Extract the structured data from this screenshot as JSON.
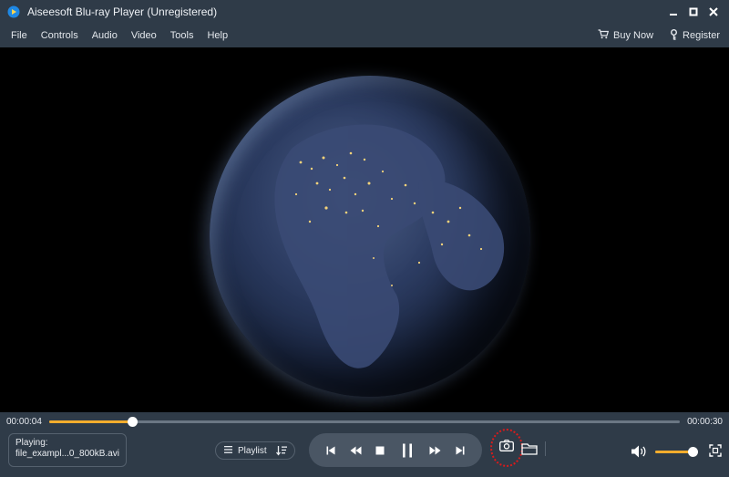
{
  "window": {
    "title": "Aiseesoft Blu-ray Player (Unregistered)"
  },
  "menu": {
    "items": [
      "File",
      "Controls",
      "Audio",
      "Video",
      "Tools",
      "Help"
    ],
    "buy_now": "Buy Now",
    "register": "Register"
  },
  "player": {
    "current_time": "00:00:04",
    "total_time": "00:00:30",
    "progress": 0.132,
    "playing_label": "Playing:",
    "file_name": "file_exampl...0_800kB.avi",
    "playlist_label": "Playlist",
    "volume": 0.9
  },
  "colors": {
    "panel": "#2f3b48",
    "accent": "#f4ad2d",
    "highlight_ring": "#d81b1b"
  },
  "icons": {
    "app": "play-logo-icon",
    "minimize": "minimize-icon",
    "maximize": "maximize-icon",
    "close": "close-icon",
    "cart": "cart-icon",
    "register": "key-icon",
    "playlist": "list-icon",
    "sort": "sort-icon",
    "prev": "skip-previous-icon",
    "rewind": "rewind-icon",
    "stop": "stop-icon",
    "pause": "pause-icon",
    "forward": "fast-forward-icon",
    "next": "skip-next-icon",
    "snapshot": "camera-icon",
    "folder": "folder-icon",
    "volume": "volume-icon",
    "fullscreen": "fullscreen-icon"
  }
}
